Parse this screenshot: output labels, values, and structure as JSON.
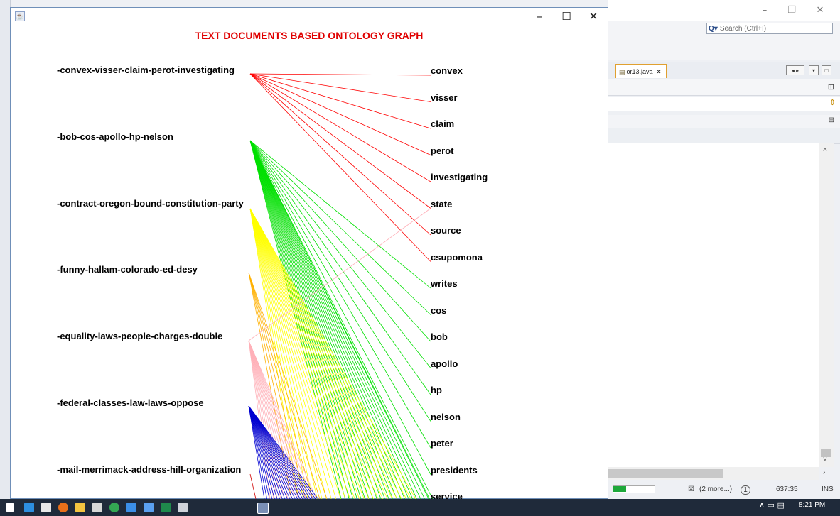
{
  "app": {
    "heading": "TEXT DOCUMENTS BASED ONTOLOGY GRAPH",
    "documents": [
      "-convex-visser-claim-perot-investigating",
      "-bob-cos-apollo-hp-nelson",
      "-contract-oregon-bound-constitution-party",
      "-funny-hallam-colorado-ed-desy",
      "-equality-laws-people-charges-double",
      "-federal-classes-law-laws-oppose",
      "-mail-merrimack-address-hill-organization"
    ],
    "terms": [
      "convex",
      "visser",
      "claim",
      "perot",
      "investigating",
      "state",
      "source",
      "csupomona",
      "writes",
      "cos",
      "bob",
      "apollo",
      "hp",
      "nelson",
      "peter",
      "presidents",
      "service"
    ],
    "edge_colors": {
      "doc1": "#ff0000",
      "doc2": "#00e000",
      "doc3": "#ffff00",
      "doc4": "#ffb000",
      "doc5": "#ffb0b8",
      "doc6": "#0000d0",
      "doc7": "#d00000"
    }
  },
  "ide": {
    "search_placeholder": "Search (Ctrl+I)",
    "tab_label": "or13.java",
    "status_more": "(2 more...)",
    "cursor_pos": "637:35",
    "insert_mode": "INS"
  },
  "taskbar": {
    "time": "8:21 PM"
  }
}
